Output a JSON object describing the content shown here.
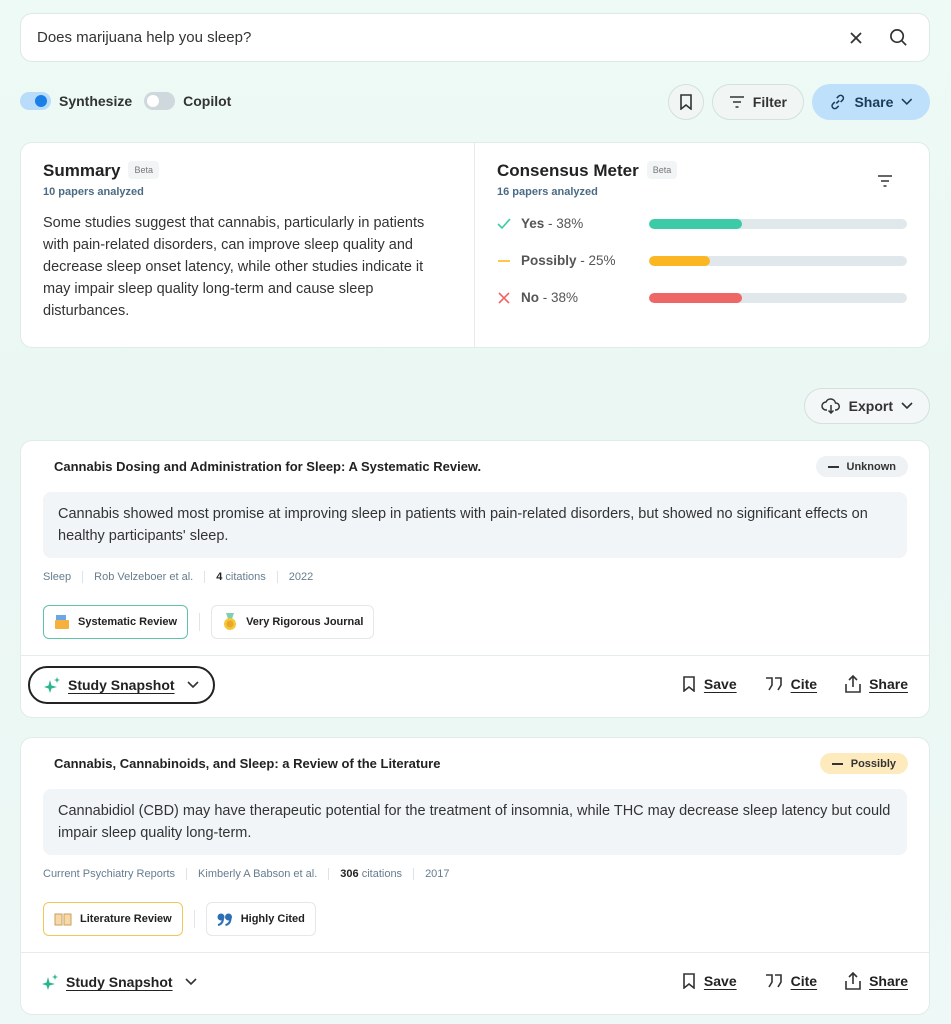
{
  "search": {
    "value": "Does marijuana help you sleep?",
    "clear_icon": "close-icon",
    "search_icon": "search-icon"
  },
  "toggles": {
    "synthesize": {
      "label": "Synthesize",
      "on": true
    },
    "copilot": {
      "label": "Copilot",
      "on": false
    }
  },
  "toolbar": {
    "filter_label": "Filter",
    "share_label": "Share",
    "export_label": "Export"
  },
  "summary": {
    "title": "Summary",
    "badge": "Beta",
    "papers": "10 papers analyzed",
    "text": "Some studies suggest that cannabis, particularly in patients with pain-related disorders, can improve sleep quality and decrease sleep onset latency, while other studies indicate it may impair sleep quality long-term and cause sleep disturbances."
  },
  "consensus": {
    "title": "Consensus Meter",
    "badge": "Beta",
    "papers": "16 papers analyzed",
    "rows": [
      {
        "label": "Yes",
        "pct": "38%",
        "value": 38,
        "color": "#3ccba6"
      },
      {
        "label": "Possibly",
        "pct": "25%",
        "value": 25,
        "color": "#fbb723"
      },
      {
        "label": "No",
        "pct": "38%",
        "value": 38,
        "color": "#ee6666"
      }
    ]
  },
  "results": [
    {
      "title": "Cannabis Dosing and Administration for Sleep: A Systematic Review.",
      "badge": "Unknown",
      "claim": "Cannabis showed most promise at improving sleep in patients with pain-related disorders, but showed no significant effects on healthy participants' sleep.",
      "journal": "Sleep",
      "authors": "Rob Velzeboer et al.",
      "citations": "4",
      "citations_label": "citations",
      "year": "2022",
      "tags": [
        "Systematic Review",
        "Very Rigorous Journal"
      ],
      "snapshot": "Study Snapshot",
      "save": "Save",
      "cite": "Cite",
      "share": "Share"
    },
    {
      "title": "Cannabis, Cannabinoids, and Sleep: a Review of the Literature",
      "badge": "Possibly",
      "claim": "Cannabidiol (CBD) may have therapeutic potential for the treatment of insomnia, while THC may decrease sleep latency but could impair sleep quality long-term.",
      "journal": "Current Psychiatry Reports",
      "authors": "Kimberly A Babson et al.",
      "citations": "306",
      "citations_label": "citations",
      "year": "2017",
      "tags": [
        "Literature Review",
        "Highly Cited"
      ],
      "snapshot": "Study Snapshot",
      "save": "Save",
      "cite": "Cite",
      "share": "Share"
    }
  ]
}
